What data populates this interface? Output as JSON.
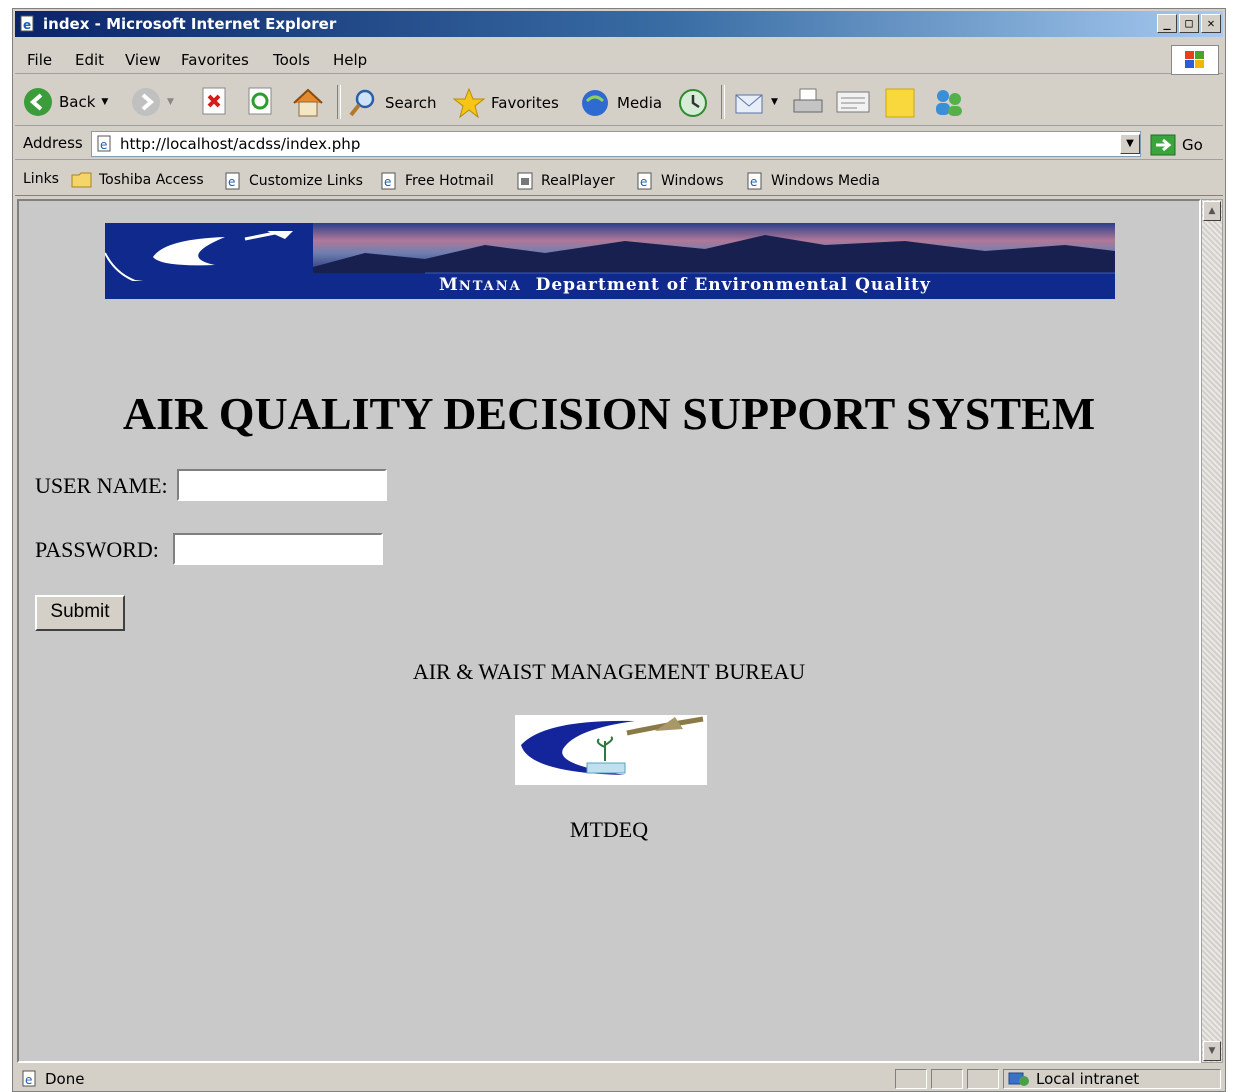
{
  "window": {
    "title": "index - Microsoft Internet Explorer"
  },
  "menu": [
    "File",
    "Edit",
    "View",
    "Favorites",
    "Tools",
    "Help"
  ],
  "toolbar": {
    "back": "Back",
    "search": "Search",
    "favorites": "Favorites",
    "media": "Media"
  },
  "address": {
    "label": "Address",
    "url": "http://localhost/acdss/index.php",
    "go": "Go"
  },
  "links": {
    "label": "Links",
    "items": [
      "Toshiba Access",
      "Customize Links",
      "Free Hotmail",
      "RealPlayer",
      "Windows",
      "Windows Media"
    ]
  },
  "banner": {
    "brand_m": "M",
    "brand_rest": "NTANA",
    "dept": "Department of Environmental Quality"
  },
  "page": {
    "heading": "AIR QUALITY DECISION SUPPORT SYSTEM",
    "username_label": "USER NAME:",
    "password_label": "PASSWORD:",
    "username_value": "",
    "password_value": "",
    "submit": "Submit",
    "bureau": "AIR & WAIST MANAGEMENT BUREAU",
    "footer": "MTDEQ"
  },
  "status": {
    "left": "Done",
    "zone": "Local intranet"
  }
}
